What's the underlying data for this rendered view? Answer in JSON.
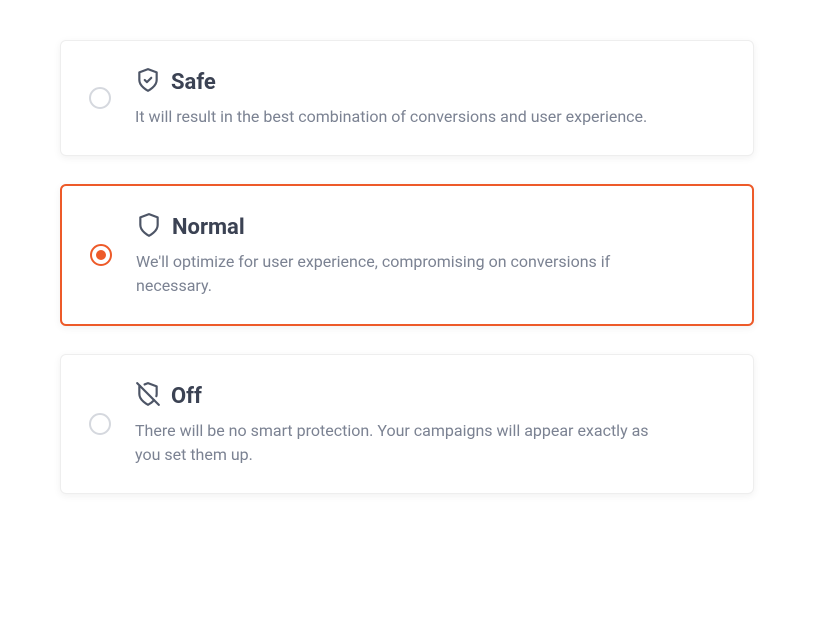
{
  "options": [
    {
      "icon": "shield-check-icon",
      "title": "Safe",
      "description": "It will result in the best combination of conversions and user experience.",
      "selected": false
    },
    {
      "icon": "shield-icon",
      "title": "Normal",
      "description": "We'll optimize for user experience, compromising on conversions if necessary.",
      "selected": true
    },
    {
      "icon": "shield-off-icon",
      "title": "Off",
      "description": "There will be no smart protection. Your campaigns will appear exactly as you set them up.",
      "selected": false
    }
  ],
  "colors": {
    "accent": "#ed5a29",
    "title": "#3b4253",
    "body": "#7b8292"
  }
}
